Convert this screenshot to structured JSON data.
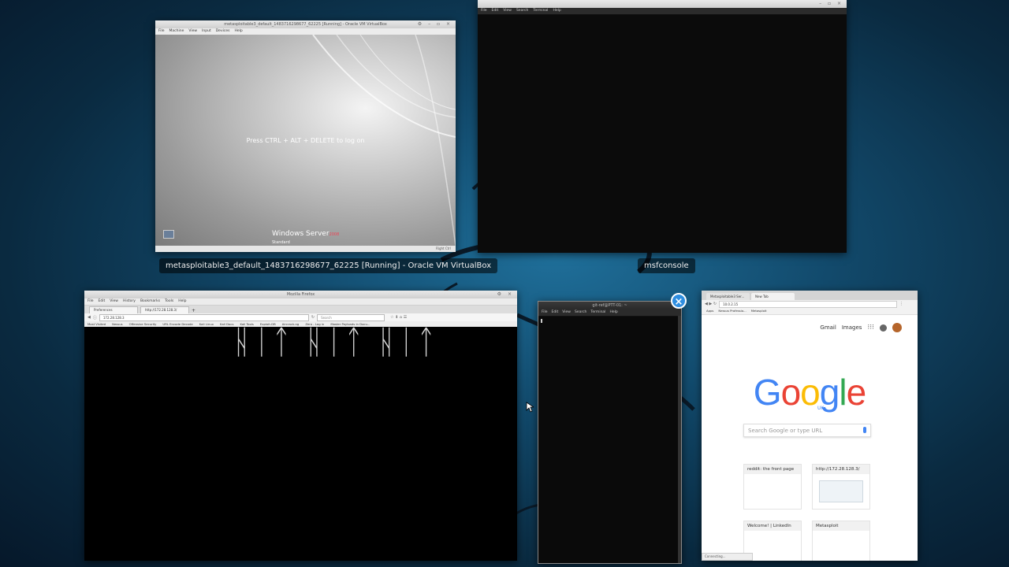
{
  "windows": {
    "vbox": {
      "title": "metasploitable3_default_1483716298677_62225 [Running] - Oracle VM VirtualBox",
      "menu": [
        "File",
        "Machine",
        "View",
        "Input",
        "Devices",
        "Help"
      ],
      "logon_text": "Press CTRL + ALT + DELETE to log on",
      "os_logo": "Windows Server",
      "os_year": "2008",
      "os_edition": "Standard",
      "status_right": "Right Ctrl",
      "caption": "metasploitable3_default_1483716298677_62225 [Running] - Oracle VM VirtualBox"
    },
    "msf": {
      "menu": [
        "File",
        "Edit",
        "View",
        "Search",
        "Terminal",
        "Help"
      ],
      "caption": "msfconsole"
    },
    "firefox": {
      "title": "Mozilla Firefox",
      "menu": [
        "File",
        "Edit",
        "View",
        "History",
        "Bookmarks",
        "Tools",
        "Help"
      ],
      "tabs": [
        "Preferences",
        "http://172.28.128.3/"
      ],
      "url": "172.28.128.3",
      "search_placeholder": "Search",
      "bookmarks": [
        "Most Visited",
        "Nessus",
        "Offensive Security",
        "URL Encode Decode",
        "Kali Linux",
        "Kali Docs",
        "Kali Tools",
        "Exploit-DB",
        "Aircrack-ng",
        "Zero - Log in",
        "Master Payloads in Docu..."
      ],
      "page_art": "ᚺᛁᛏ ᚺᛁᛏ ᚺᛁᛏ"
    },
    "terminal2": {
      "title": "git-ref@PTT-01: ~",
      "menu": [
        "File",
        "Edit",
        "View",
        "Search",
        "Terminal",
        "Help"
      ]
    },
    "chrome": {
      "tabs": [
        "Metasploitable3 Ser...",
        "New Tab"
      ],
      "url": "10.0.2.15",
      "bookmarks": [
        "Apps",
        "Nessus Professio...",
        "Metasploit"
      ],
      "header_links": [
        "Gmail",
        "Images"
      ],
      "logo_letters": [
        "G",
        "o",
        "o",
        "g",
        "l",
        "e"
      ],
      "logo_sub": "UK",
      "search_placeholder": "Search Google or type URL",
      "tiles": [
        "reddit: the front page",
        "http://172.28.128.3/",
        "Welcome! | LinkedIn",
        "Metasploit"
      ],
      "status": "Connecting..."
    }
  },
  "close_button": "×",
  "colors": {
    "google_blue": "#4285f4",
    "google_red": "#ea4335",
    "google_yellow": "#fbbc05",
    "google_green": "#34a853",
    "msf_red": "#e0443e"
  }
}
